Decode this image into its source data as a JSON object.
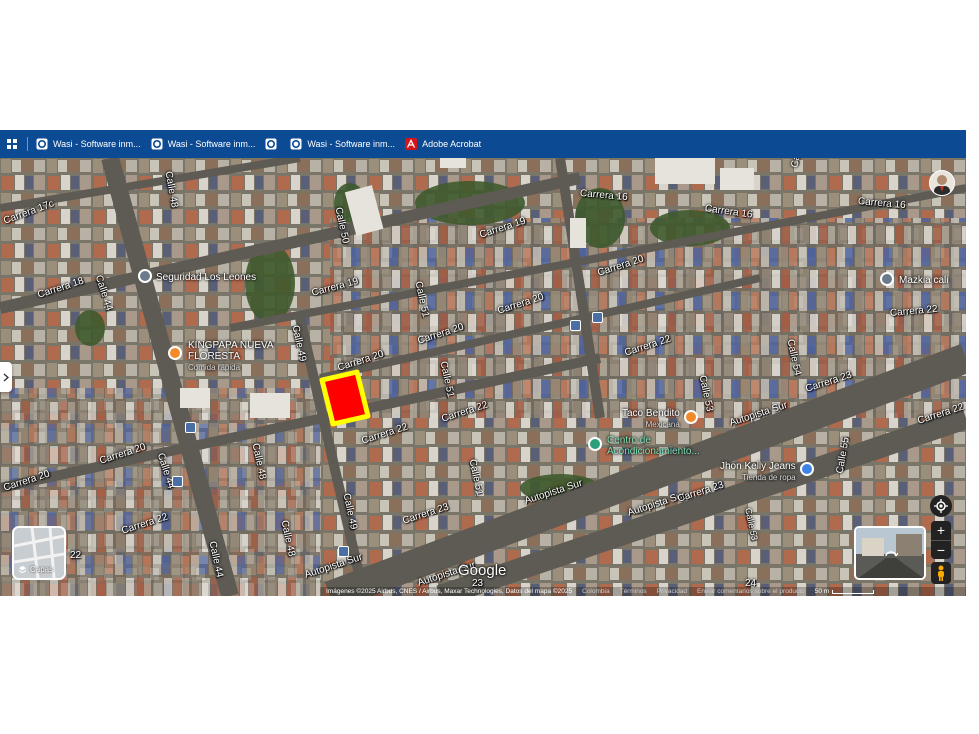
{
  "bookmarks": [
    {
      "label": "Wasi - Software inm...",
      "icon": "wasi-icon"
    },
    {
      "label": "Wasi - Software inm...",
      "icon": "wasi-icon"
    },
    {
      "label": "",
      "icon": "wasi-icon"
    },
    {
      "label": "Wasi - Software inm...",
      "icon": "wasi-icon"
    },
    {
      "label": "Adobe Acrobat",
      "icon": "acrobat-icon"
    }
  ],
  "streets": {
    "carrera_17c": "Carrera 17c",
    "calle_48_top": "Calle 48",
    "carrera_16_a": "Carrera 16",
    "carrera_16_b": "Carrera 16",
    "calle_54": "Calle 54",
    "carrera_16_right": "Carrera 16",
    "calle_50": "Calle 50",
    "carrera_19_a": "Carrera 19",
    "carrera_18": "Carrera 18",
    "calle_44_left": "Calle 44",
    "carrera_19_b": "Carrera 19",
    "calle_51_a": "Calle 51",
    "carrera_20_a": "Carrera 20",
    "carrera_20_b": "Carrera 20",
    "carrera_22_right": "Carrera 22",
    "calle_49_a": "Calle 49",
    "carrera_20_c": "Carrera 20",
    "calle_51_b": "Calle 51",
    "carrera_22_a": "Carrera 22",
    "calle_54_b": "Calle 54",
    "calle_53": "Calle 53",
    "carrera_23_right": "Carrera 23",
    "autopista_sur_a": "Autopista Sur",
    "carrera_22_b": "Carrera 22",
    "calle_48_mid": "Calle 48",
    "carrera_22_c": "Carrera 22",
    "carrera_20_d": "Carrera 20",
    "calle_44_mid": "Calle 44",
    "carrera_20_e": "Carrera 20",
    "calle_51_c": "Calle 51",
    "carrera_22_far": "Carrera 22",
    "calle_49_b": "Calle 49",
    "autopista_sur_b": "Autopista Sur",
    "autopista_sur_c": "Autopista Sur",
    "carrera_23_a": "Carrera 23",
    "calle_53_b": "Calle 53",
    "calle_55": "Calle 55",
    "carrera_22_d": "Carrera 22",
    "calle_48_bot": "Calle 48",
    "calle_44_bot": "Calle 44",
    "num_22": "22",
    "autopista_sur_d": "Autopista Sur",
    "autopista_sur_e": "Autopista Sur",
    "num_23": "23",
    "num_24": "24"
  },
  "pois": {
    "seguridad": "Seguridad Los Leones",
    "mazkia": "Mazkia cali",
    "kingpapa": "KINGPAPA NUEVA FLORESTA",
    "kingpapa_sub": "Comida rápida",
    "taco": "Taco Bendito",
    "taco_sub": "Mexicana",
    "centro": "Centro de Acondicionamiento...",
    "jhon": "Jhon Kelly Jeans",
    "jhon_sub": "Tienda de ropa"
  },
  "controls": {
    "layers_label": "Capas",
    "zoom_in": "+",
    "zoom_out": "−",
    "logo": "Google"
  },
  "footer": {
    "attribution": "Imágenes ©2025 Airbus, CNES / Airbus, Maxar Technologies, Datos del mapa ©2025",
    "country": "Colombia",
    "terms": "Términos",
    "privacy": "Privacidad",
    "feedback": "Enviar comentarios sobre el producto",
    "scale": "50 m"
  },
  "colors": {
    "bookmark_bar": "#0c4a94",
    "parcel_fill": "#ff0000",
    "parcel_border": "#ffff00"
  }
}
